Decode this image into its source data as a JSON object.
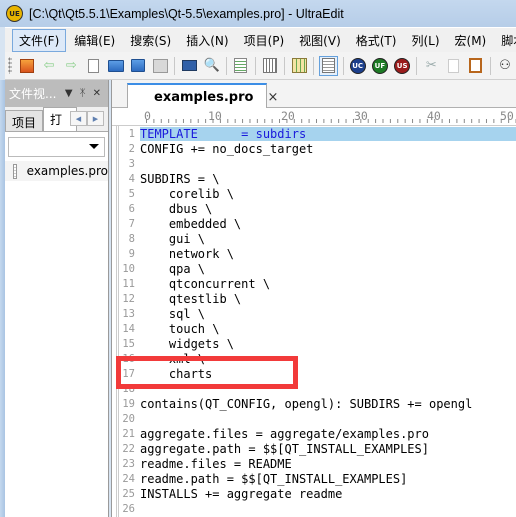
{
  "window": {
    "title": "[C:\\Qt\\Qt5.5.1\\Examples\\Qt-5.5\\examples.pro] - UltraEdit",
    "app_icon": "ultraedit-logo-icon"
  },
  "menubar": {
    "items": [
      {
        "label": "文件(F)",
        "active": true
      },
      {
        "label": "编辑(E)"
      },
      {
        "label": "搜索(S)"
      },
      {
        "label": "插入(N)"
      },
      {
        "label": "项目(P)"
      },
      {
        "label": "视图(V)"
      },
      {
        "label": "格式(T)"
      },
      {
        "label": "列(L)"
      },
      {
        "label": "宏(M)"
      },
      {
        "label": "脚本"
      }
    ]
  },
  "toolbar": {
    "buttons": [
      "open-recent-icon",
      "back-arrow-icon",
      "forward-arrow-icon",
      "new-file-icon",
      "open-folder-icon",
      "open-file-icon",
      "save-icon",
      "print-icon",
      "print-preview-icon",
      "wordwrap-icon",
      "hex-edit-icon",
      "column-mode-icon",
      "line-numbers-icon",
      "uc-icon",
      "uf-icon",
      "us-icon",
      "cut-icon",
      "copy-icon",
      "paste-icon",
      "find-icon"
    ],
    "badges": {
      "uc": "UC",
      "uf": "UF",
      "us": "US"
    }
  },
  "left_panel": {
    "title": "文件视...",
    "tabs": [
      {
        "label": "项目"
      },
      {
        "label": "打",
        "active": true
      }
    ],
    "combo_value": "",
    "files": [
      {
        "name": "examples.pro"
      }
    ]
  },
  "editor": {
    "tab_label": "examples.pro",
    "close_glyph": "×",
    "ruler": [
      "0",
      "10",
      "20",
      "30",
      "40",
      "50"
    ],
    "lines": [
      {
        "n": "1",
        "text": "TEMPLATE      = subdirs",
        "highlight": true
      },
      {
        "n": "2",
        "text": "CONFIG += no_docs_target"
      },
      {
        "n": "3",
        "text": ""
      },
      {
        "n": "4",
        "text": "SUBDIRS = \\"
      },
      {
        "n": "5",
        "text": "    corelib \\"
      },
      {
        "n": "6",
        "text": "    dbus \\"
      },
      {
        "n": "7",
        "text": "    embedded \\"
      },
      {
        "n": "8",
        "text": "    gui \\"
      },
      {
        "n": "9",
        "text": "    network \\"
      },
      {
        "n": "10",
        "text": "    qpa \\"
      },
      {
        "n": "11",
        "text": "    qtconcurrent \\"
      },
      {
        "n": "12",
        "text": "    qtestlib \\"
      },
      {
        "n": "13",
        "text": "    sql \\"
      },
      {
        "n": "14",
        "text": "    touch \\"
      },
      {
        "n": "15",
        "text": "    widgets \\"
      },
      {
        "n": "16",
        "text": "    xml \\"
      },
      {
        "n": "17",
        "text": "    charts"
      },
      {
        "n": "18",
        "text": ""
      },
      {
        "n": "19",
        "text": "contains(QT_CONFIG, opengl): SUBDIRS += opengl"
      },
      {
        "n": "20",
        "text": ""
      },
      {
        "n": "21",
        "text": "aggregate.files = aggregate/examples.pro"
      },
      {
        "n": "22",
        "text": "aggregate.path = $$[QT_INSTALL_EXAMPLES]"
      },
      {
        "n": "23",
        "text": "readme.files = README"
      },
      {
        "n": "24",
        "text": "readme.path = $$[QT_INSTALL_EXAMPLES]"
      },
      {
        "n": "25",
        "text": "INSTALLS += aggregate readme"
      },
      {
        "n": "26",
        "text": ""
      }
    ]
  },
  "annotation": {
    "color": "#f23a3a",
    "target_lines": [
      "16",
      "17",
      "18"
    ]
  }
}
